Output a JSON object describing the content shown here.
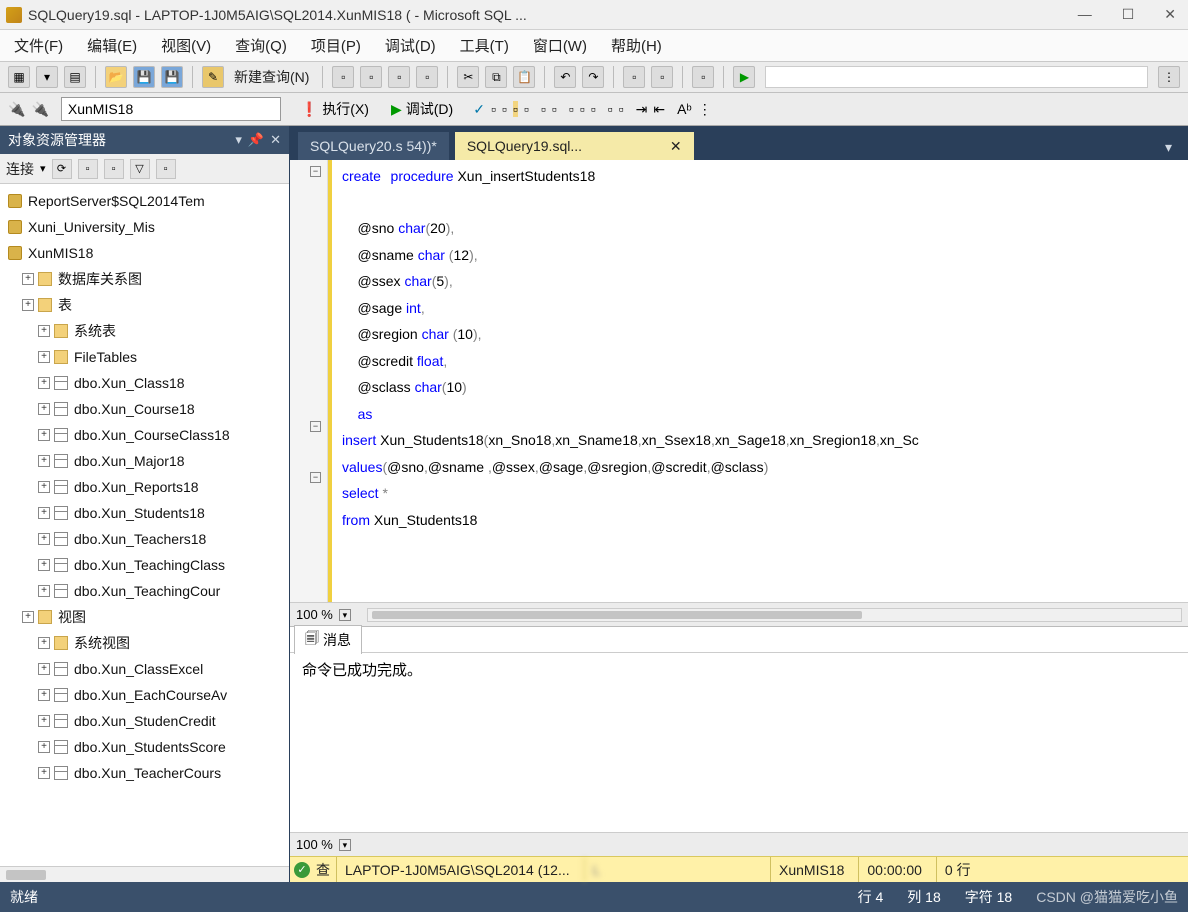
{
  "title": "SQLQuery19.sql - LAPTOP-1J0M5AIG\\SQL2014.XunMIS18 (                                       - Microsoft SQL ...",
  "menu": [
    "文件(F)",
    "编辑(E)",
    "视图(V)",
    "查询(Q)",
    "项目(P)",
    "调试(D)",
    "工具(T)",
    "窗口(W)",
    "帮助(H)"
  ],
  "toolbar1": {
    "new_query": "新建查询(N)"
  },
  "toolbar2": {
    "db_value": "XunMIS18",
    "execute": "执行(X)",
    "debug": "调试(D)"
  },
  "object_explorer": {
    "title": "对象资源管理器",
    "connect": "连接",
    "databases": [
      "ReportServer$SQL2014Tem",
      "Xuni_University_Mis",
      "XunMIS18"
    ],
    "nodes": [
      {
        "label": "数据库关系图",
        "level": 2,
        "icon": "fold"
      },
      {
        "label": "表",
        "level": 2,
        "icon": "fold"
      },
      {
        "label": "系统表",
        "level": 3,
        "icon": "fold"
      },
      {
        "label": "FileTables",
        "level": 3,
        "icon": "fold"
      },
      {
        "label": "dbo.Xun_Class18",
        "level": 3,
        "icon": "tbl"
      },
      {
        "label": "dbo.Xun_Course18",
        "level": 3,
        "icon": "tbl"
      },
      {
        "label": "dbo.Xun_CourseClass18",
        "level": 3,
        "icon": "tbl"
      },
      {
        "label": "dbo.Xun_Major18",
        "level": 3,
        "icon": "tbl"
      },
      {
        "label": "dbo.Xun_Reports18",
        "level": 3,
        "icon": "tbl"
      },
      {
        "label": "dbo.Xun_Students18",
        "level": 3,
        "icon": "tbl"
      },
      {
        "label": "dbo.Xun_Teachers18",
        "level": 3,
        "icon": "tbl"
      },
      {
        "label": "dbo.Xun_TeachingClass",
        "level": 3,
        "icon": "tbl"
      },
      {
        "label": "dbo.Xun_TeachingCour",
        "level": 3,
        "icon": "tbl"
      },
      {
        "label": "视图",
        "level": 2,
        "icon": "fold"
      },
      {
        "label": "系统视图",
        "level": 3,
        "icon": "fold"
      },
      {
        "label": "dbo.Xun_ClassExcel",
        "level": 3,
        "icon": "tbl"
      },
      {
        "label": "dbo.Xun_EachCourseAv",
        "level": 3,
        "icon": "tbl"
      },
      {
        "label": "dbo.Xun_StudenCredit",
        "level": 3,
        "icon": "tbl"
      },
      {
        "label": "dbo.Xun_StudentsScore",
        "level": 3,
        "icon": "tbl"
      },
      {
        "label": "dbo.Xun_TeacherCours",
        "level": 3,
        "icon": "tbl"
      }
    ]
  },
  "tabs": [
    {
      "label": "SQLQuery20.s                     54))*",
      "active": false
    },
    {
      "label": "SQLQuery19.sql...",
      "active": true
    }
  ],
  "zoom": "100 %",
  "messages": {
    "tab": "消息",
    "body": "命令已成功完成。"
  },
  "status_yellow": {
    "q": "查",
    "server": "LAPTOP-1J0M5AIG\\SQL2014 (12...",
    "login": "L",
    "db": "XunMIS18",
    "time": "00:00:00",
    "rows": "0 行"
  },
  "status_bottom": {
    "ready": "就绪",
    "line": "行 4",
    "col": "列 18",
    "char": "字符 18",
    "watermark": "CSDN @猫猫爱吃小鱼"
  },
  "code": {
    "l1a": "create",
    "l1b": "procedure",
    "l1c": " Xun_insertStudents18",
    "l3": "    @sno ",
    "l3b": "char",
    "l3c": "(",
    "l3d": "20",
    "l3e": "),",
    "l4": "    @sname ",
    "l4b": "char",
    "l4c": " (",
    "l4d": "12",
    "l4e": "),",
    "l5": "    @ssex ",
    "l5b": "char",
    "l5c": "(",
    "l5d": "5",
    "l5e": "),",
    "l6": "    @sage ",
    "l6b": "int",
    "l6c": ",",
    "l7": "    @sregion ",
    "l7b": "char",
    "l7c": " (",
    "l7d": "10",
    "l7e": "),",
    "l8": "    @scredit ",
    "l8b": "float",
    "l8c": ",",
    "l9": "    @sclass ",
    "l9b": "char",
    "l9c": "(",
    "l9d": "10",
    "l9e": ")",
    "l10": "    ",
    "l10b": "as",
    "l11a": "insert",
    "l11b": " Xun_Students18",
    "l11c": "(",
    "l11d": "xn_Sno18",
    "l11e": ",",
    "l11f": "xn_Sname18",
    "l11g": ",",
    "l11h": "xn_Ssex18",
    "l11i": ",",
    "l11j": "xn_Sage18",
    "l11k": ",",
    "l11l": "xn_Sregion18",
    "l11m": ",",
    "l11n": "xn_Sc",
    "l12a": "values",
    "l12b": "(",
    "l12c": "@sno",
    "l12d": ",",
    "l12e": "@sname ",
    "l12f": ",",
    "l12g": "@ssex",
    "l12h": ",",
    "l12i": "@sage",
    "l12j": ",",
    "l12k": "@sregion",
    "l12l": ",",
    "l12m": "@scredit",
    "l12n": ",",
    "l12o": "@sclass",
    "l12p": ")",
    "l13a": "select",
    "l13b": " *",
    "l14a": "from",
    "l14b": " Xun_Students18"
  }
}
